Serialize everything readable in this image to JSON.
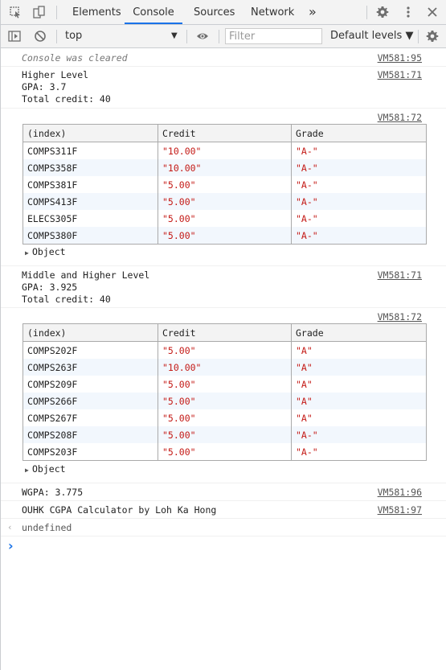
{
  "tabs": {
    "items": [
      "Elements",
      "Console",
      "Sources",
      "Network"
    ],
    "active": "Console",
    "more": "»"
  },
  "toolbar": {
    "context": "top",
    "filter_placeholder": "Filter",
    "levels": "Default levels ▼"
  },
  "messages": {
    "cleared": {
      "text": "Console was cleared",
      "source": "VM581:95"
    },
    "higher": {
      "lines": [
        "Higher Level",
        "GPA: 3.7",
        "Total credit: 40"
      ],
      "source": "VM581:71"
    },
    "table1": {
      "source": "VM581:72",
      "headers": [
        "(index)",
        "Credit",
        "Grade"
      ],
      "rows": [
        [
          "COMPS311F",
          "\"10.00\"",
          "\"A-\""
        ],
        [
          "COMPS358F",
          "\"10.00\"",
          "\"A-\""
        ],
        [
          "COMPS381F",
          "\"5.00\"",
          "\"A-\""
        ],
        [
          "COMPS413F",
          "\"5.00\"",
          "\"A-\""
        ],
        [
          "ELECS305F",
          "\"5.00\"",
          "\"A-\""
        ],
        [
          "COMPS380F",
          "\"5.00\"",
          "\"A-\""
        ]
      ],
      "object_label": "Object"
    },
    "middle": {
      "lines": [
        "Middle and Higher Level",
        "GPA: 3.925",
        "Total credit: 40"
      ],
      "source": "VM581:71"
    },
    "table2": {
      "source": "VM581:72",
      "headers": [
        "(index)",
        "Credit",
        "Grade"
      ],
      "rows": [
        [
          "COMPS202F",
          "\"5.00\"",
          "\"A\""
        ],
        [
          "COMPS263F",
          "\"10.00\"",
          "\"A\""
        ],
        [
          "COMPS209F",
          "\"5.00\"",
          "\"A\""
        ],
        [
          "COMPS266F",
          "\"5.00\"",
          "\"A\""
        ],
        [
          "COMPS267F",
          "\"5.00\"",
          "\"A\""
        ],
        [
          "COMPS208F",
          "\"5.00\"",
          "\"A-\""
        ],
        [
          "COMPS203F",
          "\"5.00\"",
          "\"A-\""
        ]
      ],
      "object_label": "Object"
    },
    "wgpa": {
      "text": "WGPA: 3.775",
      "source": "VM581:96"
    },
    "credit": {
      "text": "OUHK CGPA Calculator by Loh Ka Hong",
      "source": "VM581:97"
    },
    "result": {
      "text": "undefined"
    }
  },
  "prompt": {
    "symbol": "›"
  }
}
